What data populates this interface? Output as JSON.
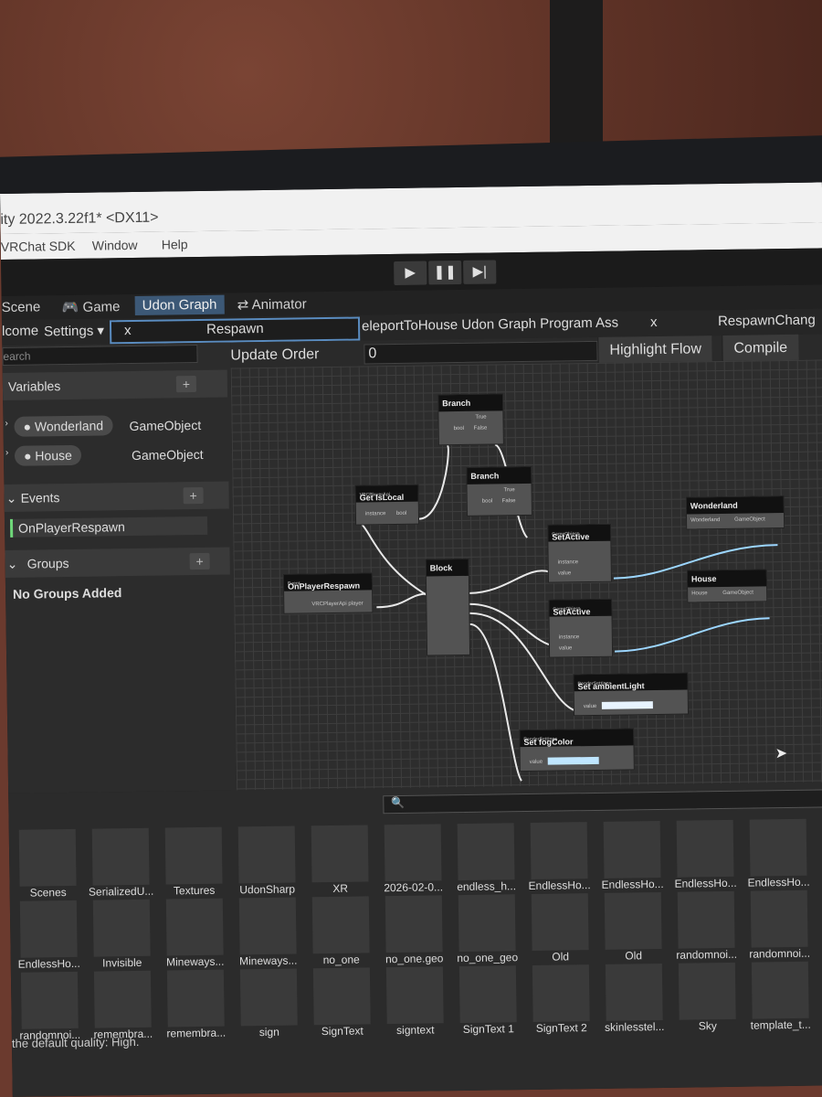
{
  "window": {
    "title": "ity 2022.3.22f1* <DX11>"
  },
  "menu": [
    "VRChat SDK",
    "Window",
    "Help"
  ],
  "tabs": {
    "scene": "Scene",
    "game": "Game",
    "udon": "Udon Graph",
    "animator": "Animator"
  },
  "subbar": {
    "welcome": "lcome",
    "settings": "Settings",
    "close1": "x",
    "respawn": "Respawn",
    "program": "eleportToHouse Udon Graph Program Ass",
    "close2": "x",
    "respawn_change": "RespawnChang"
  },
  "left": {
    "search_placeholder": "earch",
    "variables_label": "Variables",
    "variables": [
      {
        "name": "Wonderland",
        "type": "GameObject"
      },
      {
        "name": "House",
        "type": "GameObject"
      }
    ],
    "events_label": "Events",
    "events": [
      "OnPlayerRespawn"
    ],
    "groups_label": "Groups",
    "groups_empty": "No Groups Added"
  },
  "main": {
    "update_label": "Update Order",
    "update_value": "0",
    "highlight": "Highlight Flow",
    "compile": "Compile"
  },
  "nodes": {
    "branch1": {
      "title": "Branch",
      "r1": "True",
      "r2": "bool",
      "r3": "False"
    },
    "branch2": {
      "title": "Branch",
      "r1": "True",
      "r2": "bool",
      "r3": "False"
    },
    "getislocal": {
      "sub": "VRCPlayerApi",
      "title": "Get IsLocal",
      "r1": "instance",
      "r2": "bool"
    },
    "wonderland": {
      "title": "Wonderland",
      "r1": "Wonderland",
      "r2": "GameObject"
    },
    "house": {
      "title": "House",
      "r1": "House",
      "r2": "GameObject"
    },
    "setactive1": {
      "sub": "GameObject",
      "title": "SetActive",
      "r1": "instance",
      "r2": "value"
    },
    "setactive2": {
      "sub": "GameObject",
      "title": "SetActive",
      "r1": "instance",
      "r2": "value"
    },
    "respawn": {
      "sub": "Event",
      "title": "OnPlayerRespawn",
      "r1": "VRCPlayerApi player"
    },
    "block": {
      "title": "Block"
    },
    "ambient": {
      "sub": "RenderSettings",
      "title": "Set ambientLight",
      "r1": "value"
    },
    "fog": {
      "sub": "RenderSettings",
      "title": "Set fogColor",
      "r1": "value"
    }
  },
  "assets": {
    "row0": [
      "Scenes",
      "SerializedU...",
      "Textures",
      "UdonSharp",
      "XR",
      "2026-02-0...",
      "endless_h...",
      "EndlessHo...",
      "EndlessHo...",
      "EndlessHo...",
      "EndlessHo..."
    ],
    "row1": [
      "EndlessHo...",
      "Invisible",
      "Mineways...",
      "Mineways...",
      "no_one",
      "no_one.geo",
      "no_one_geo",
      "Old",
      "Old",
      "randomnoi...",
      "randomnoi..."
    ],
    "row2": [
      "randomnoi...",
      "remembra...",
      "remembra...",
      "sign",
      "SignText",
      "signtext",
      "SignText 1",
      "SignText 2",
      "skinlesstel...",
      "Sky",
      "template_t..."
    ]
  },
  "status": "the default quality: High."
}
